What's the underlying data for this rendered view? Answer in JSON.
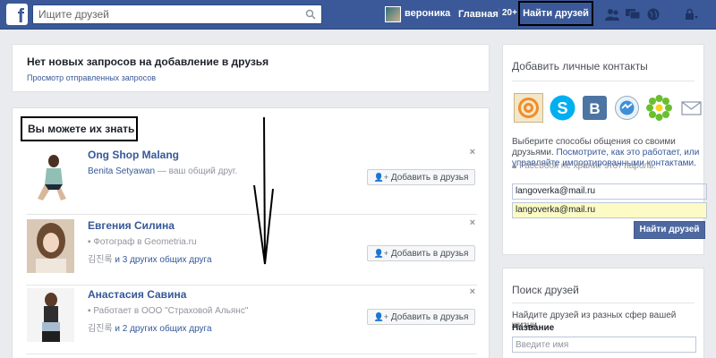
{
  "topbar": {
    "logo": "f",
    "search_placeholder": "Ищите друзей",
    "user_name": "вероника",
    "home_label": "Главная",
    "home_count": "20+",
    "find_friends_label": "Найти друзей"
  },
  "requests": {
    "title": "Нет новых запросов на добавление в друзья",
    "sent_link": "Просмотр отправленных запросов"
  },
  "pymk": {
    "title": "Вы можете их знать",
    "add_label": "Добавить в друзья",
    "close": "×",
    "people": [
      {
        "name": "Ong Shop Malang",
        "mutual_name": "Benita Setyawan",
        "mutual_suffix": " — ваш общий друг."
      },
      {
        "name": "Евгения Силина",
        "detail": "Фотограф в Geometria.ru",
        "mutual_prefix": "김진록",
        "mutual_text": " и 3 других общих друга"
      },
      {
        "name": "Анастасия Савина",
        "detail": "Работает в ООО \"Страховой Альянс\"",
        "mutual_prefix": "김진록",
        "mutual_text": " и 2 других общих друга"
      }
    ]
  },
  "contacts": {
    "title": "Добавить личные контакты",
    "desc_line1": "Выберите способы общения со своими друзьями.",
    "desc_link": "Посмотрите, как это работает, или управляйте импортированными контактами.",
    "note": "Facebook не хранит этот пароль.",
    "email_value": "langoverka@mail.ru",
    "password_value": "langoverka@mail.ru",
    "find_button": "Найти друзей",
    "services": [
      "mail-ru-icon",
      "skype-icon",
      "vkontakte-icon",
      "messenger-icon",
      "icq-icon",
      "envelope-icon"
    ]
  },
  "search_friends": {
    "title": "Поиск друзей",
    "desc": "Найдите друзей из разных сфер вашей жизни",
    "name_label": "Название",
    "name_placeholder": "Введите имя"
  },
  "colors": {
    "brand": "#3b5998",
    "link": "#365899",
    "background": "#e9ebee"
  }
}
